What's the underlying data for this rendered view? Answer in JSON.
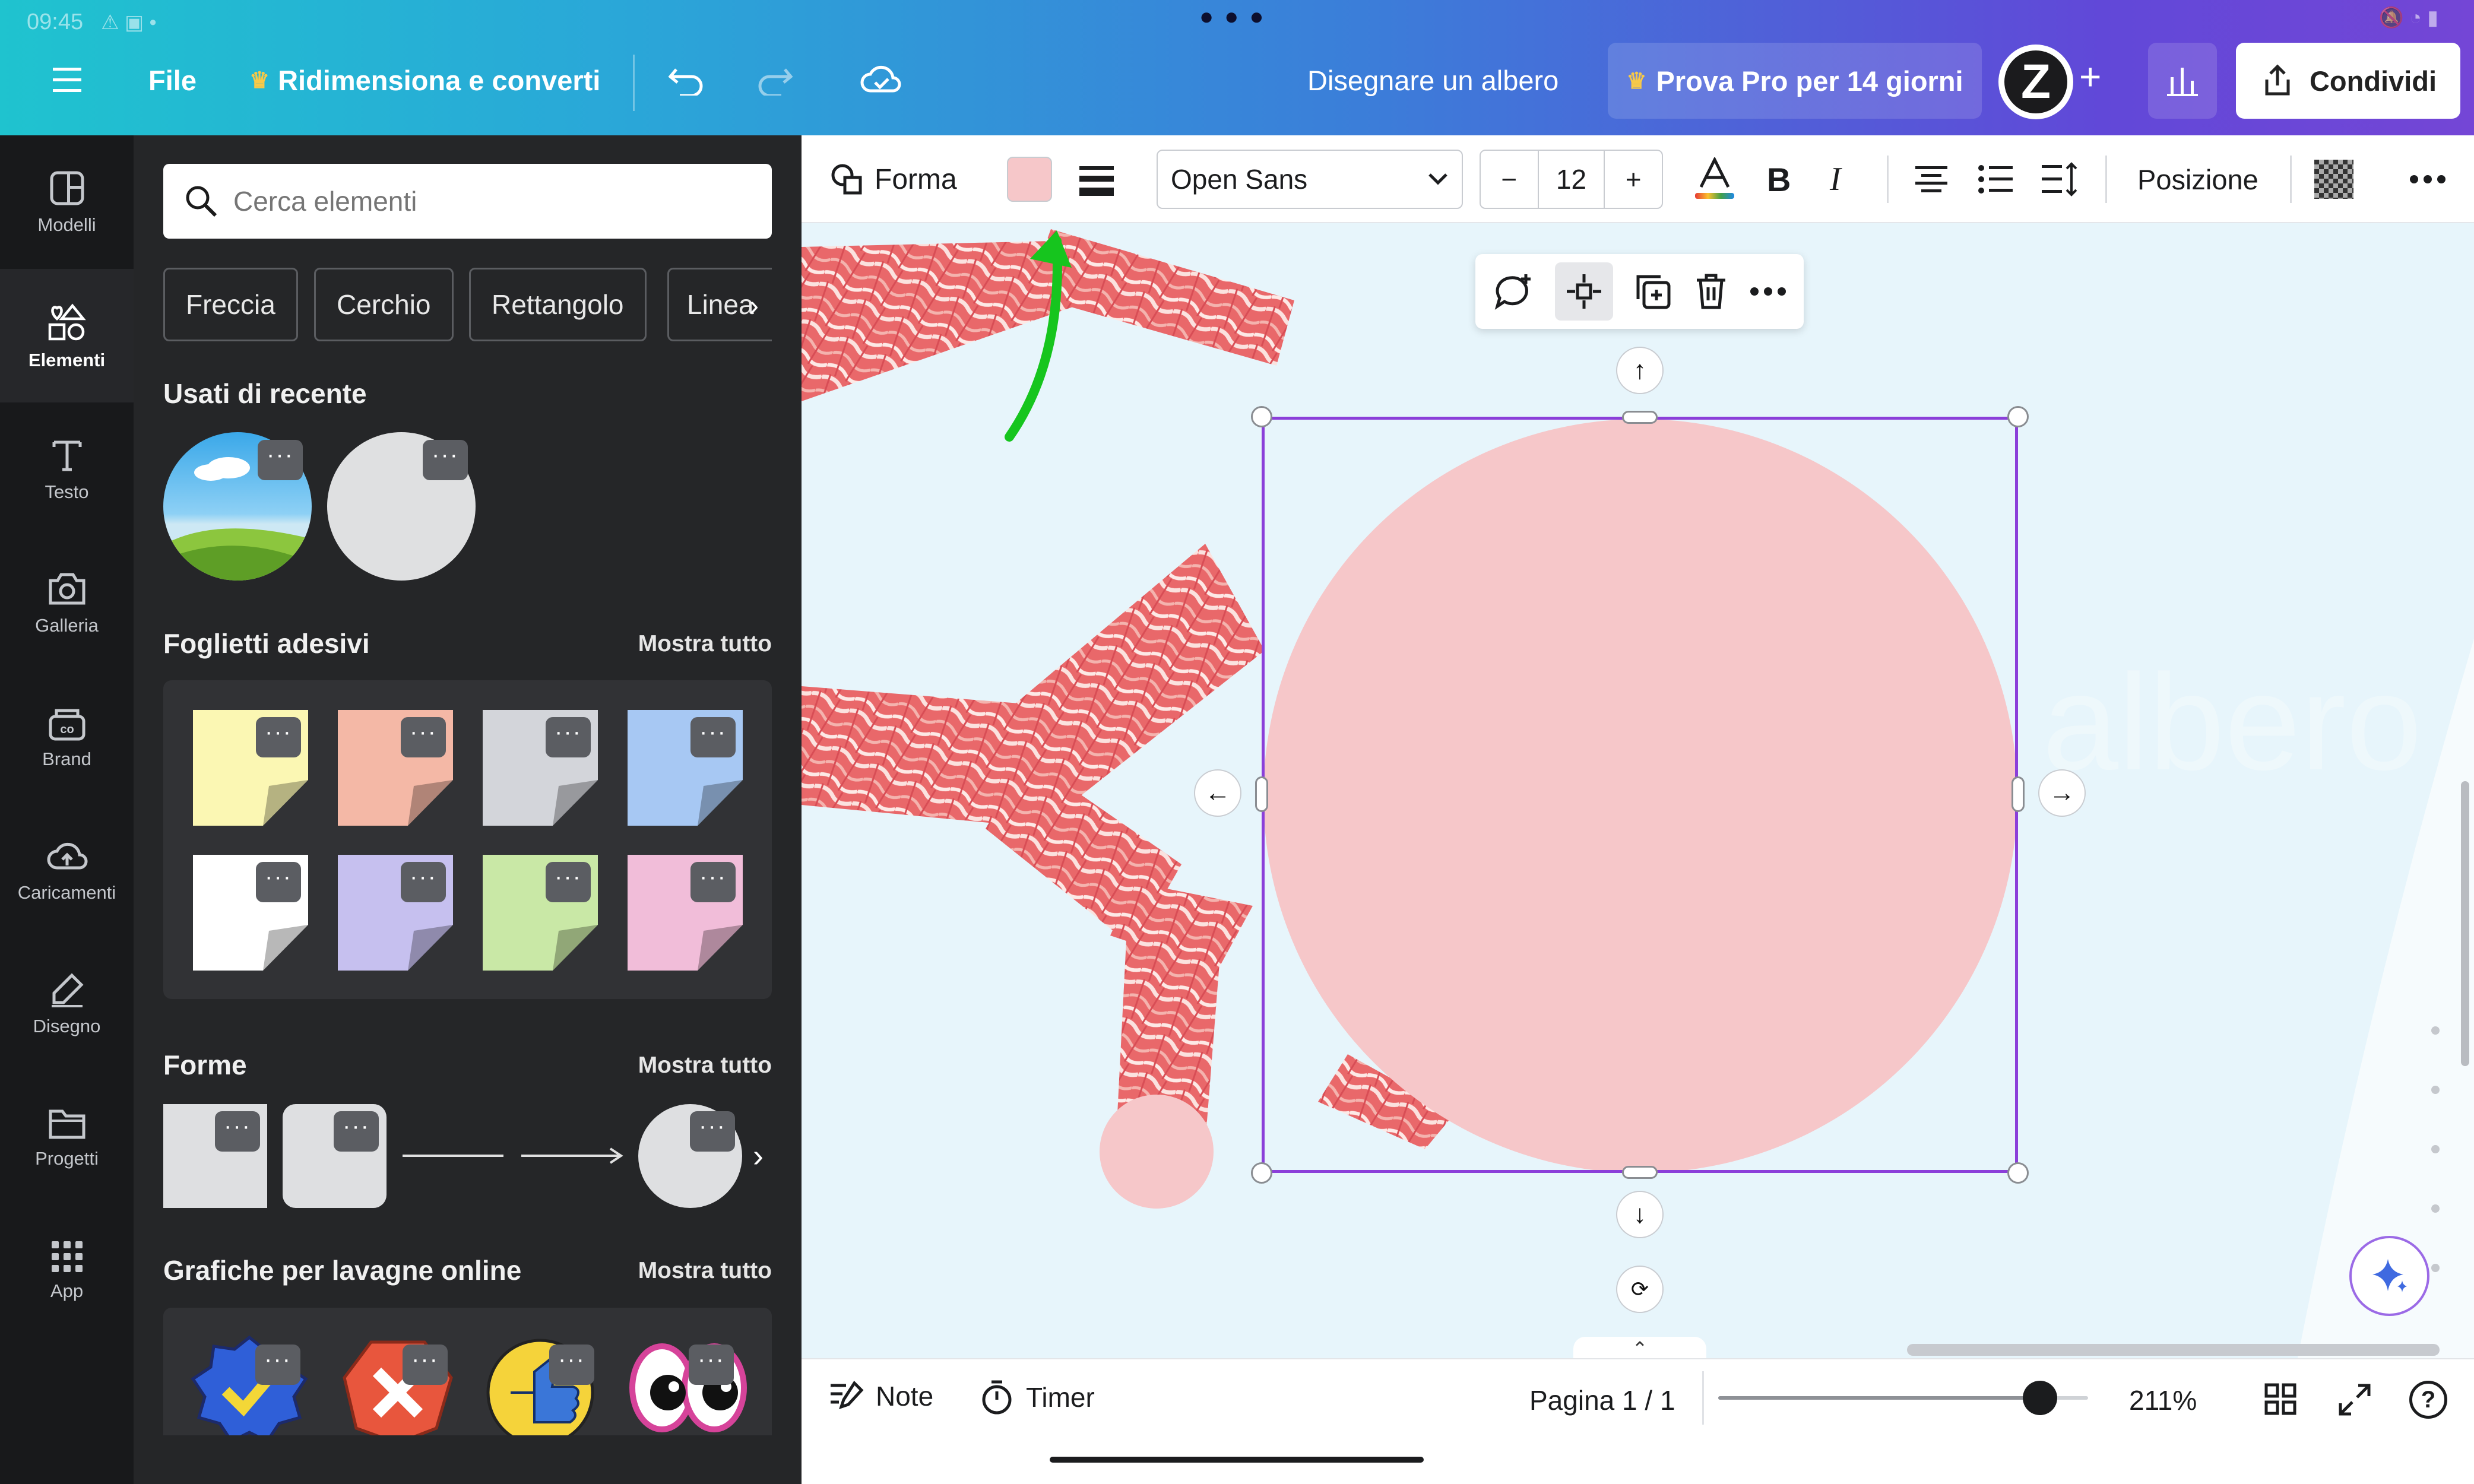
{
  "status_bar": {
    "time": "09:45"
  },
  "topbar": {
    "file_label": "File",
    "resize_label": "Ridimensiona e converti",
    "design_title": "Disegnare un albero",
    "pro_label": "Prova Pro per 14 giorni",
    "avatar_letter": "Z",
    "share_label": "Condividi"
  },
  "rail": {
    "items": [
      {
        "label": "Modelli",
        "icon": "templates-icon"
      },
      {
        "label": "Elementi",
        "icon": "elements-icon",
        "active": true
      },
      {
        "label": "Testo",
        "icon": "text-icon"
      },
      {
        "label": "Galleria",
        "icon": "camera-icon"
      },
      {
        "label": "Brand",
        "icon": "brand-icon"
      },
      {
        "label": "Caricamenti",
        "icon": "upload-cloud-icon"
      },
      {
        "label": "Disegno",
        "icon": "draw-icon"
      },
      {
        "label": "Progetti",
        "icon": "folder-icon"
      },
      {
        "label": "App",
        "icon": "apps-grid-icon"
      }
    ]
  },
  "panel": {
    "search_placeholder": "Cerca elementi",
    "chips": [
      "Freccia",
      "Cerchio",
      "Rettangolo",
      "Linea"
    ],
    "recent_title": "Usati di recente",
    "sticky_title": "Foglietti adesivi",
    "sticky_link": "Mostra tutto",
    "sticky_colors": [
      "#fbf7b3",
      "#f4b8a6",
      "#d3d5da",
      "#a7c8f3",
      "#ffffff",
      "#c6c0ef",
      "#c9e8a6",
      "#f1bdd9"
    ],
    "shapes_title": "Forme",
    "shapes_link": "Mostra tutto",
    "graphics_title": "Grafiche per lavagne online",
    "graphics_link": "Mostra tutto",
    "badge_dots": "···"
  },
  "toolbar": {
    "shape_label": "Forma",
    "fill_color": "#f6c7c9",
    "font_name": "Open Sans",
    "font_size": "12",
    "minus": "−",
    "plus": "+",
    "bold": "B",
    "italic": "I",
    "position_label": "Posizione"
  },
  "canvas": {
    "circle_color": "#f6c7c9",
    "selection_color": "#8b3fd9",
    "pointer_color": "#16c51e"
  },
  "bottombar": {
    "notes_label": "Note",
    "timer_label": "Timer",
    "page_label": "Pagina 1 / 1",
    "zoom_label": "211%",
    "zoom_fraction": 0.87,
    "help": "?"
  }
}
